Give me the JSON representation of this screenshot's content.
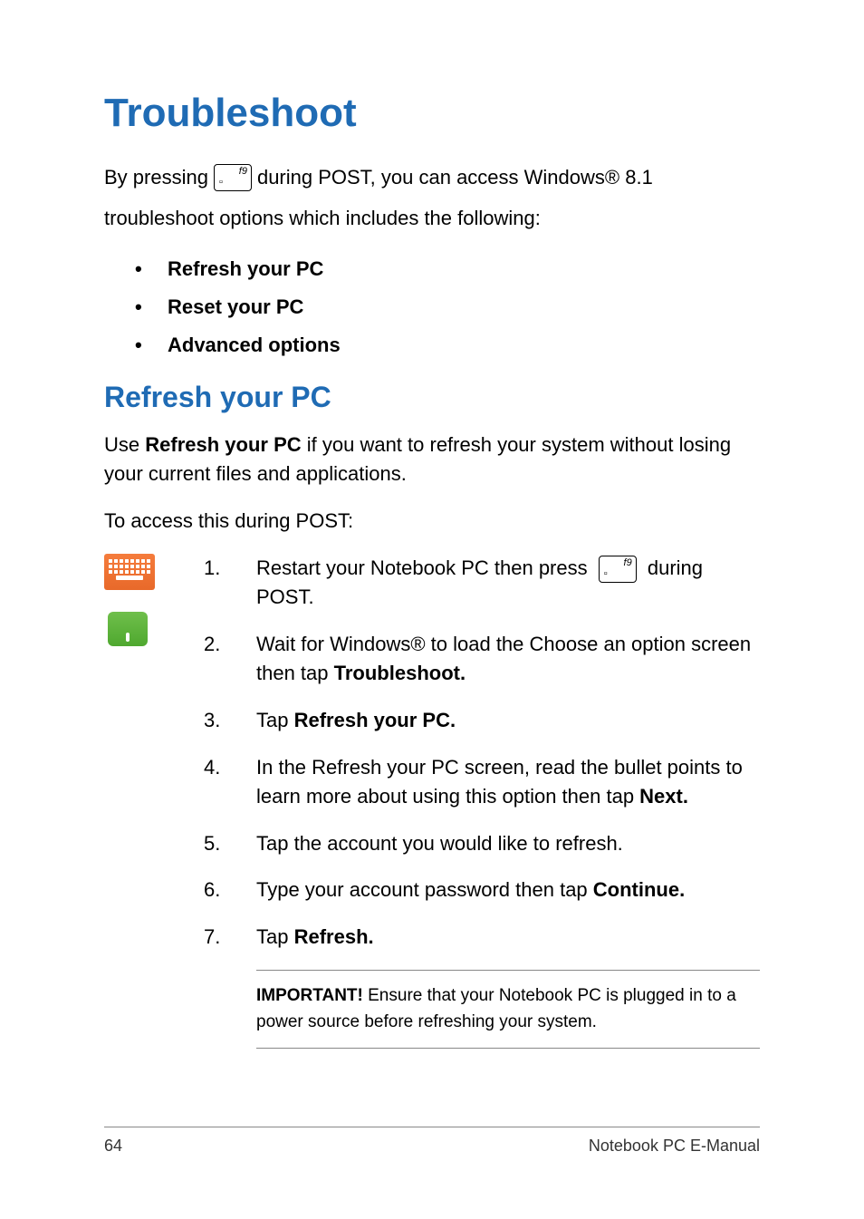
{
  "title": "Troubleshoot",
  "intro_pre": "By pressing ",
  "intro_post": " during POST, you can access Windows® 8.1",
  "intro_line2": "troubleshoot options which includes the following:",
  "key_label": "f9",
  "bullets": {
    "b1": "Refresh your PC",
    "b2": "Reset your PC",
    "b3": "Advanced options"
  },
  "subtitle": "Refresh your PC",
  "desc_pre": "Use ",
  "desc_bold": "Refresh your PC",
  "desc_post": " if you want to refresh your system without losing your current files and applications.",
  "access_line": "To access this during POST:",
  "steps": {
    "s1": {
      "num": "1.",
      "pre": "Restart your Notebook PC then press ",
      "post": " during POST."
    },
    "s2": {
      "num": "2.",
      "pre": "Wait for Windows® to load the Choose an option screen then tap ",
      "bold": "Troubleshoot."
    },
    "s3": {
      "num": "3.",
      "pre": "Tap ",
      "bold": "Refresh your PC."
    },
    "s4": {
      "num": "4.",
      "pre": "In the Refresh your PC screen, read the bullet points to learn more about using this option then tap ",
      "bold": "Next."
    },
    "s5": {
      "num": "5.",
      "text": "Tap the account you would like to refresh."
    },
    "s6": {
      "num": "6.",
      "pre": "Type your account password then tap ",
      "bold": "Continue."
    },
    "s7": {
      "num": "7.",
      "pre": "Tap ",
      "bold": "Refresh."
    }
  },
  "note_bold": "IMPORTANT!",
  "note_text": " Ensure that your Notebook PC is plugged in to a power source before refreshing your system.",
  "footer": {
    "page": "64",
    "doc": "Notebook PC E-Manual"
  }
}
